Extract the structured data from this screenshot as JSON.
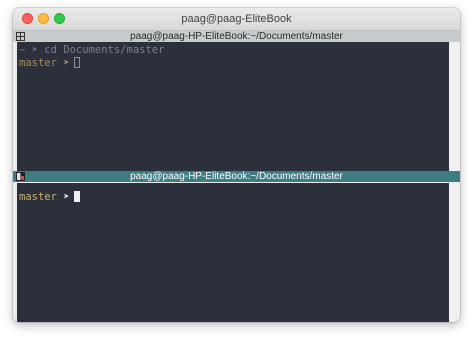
{
  "window": {
    "title": "paag@paag-EliteBook"
  },
  "top_pane": {
    "header": "",
    "history_line": {
      "tilde": "~",
      "arrow": "➤",
      "command": "cd Documents/master"
    },
    "prompt": {
      "dir": "master",
      "arrow": "➤"
    }
  },
  "bottom_pane": {
    "header": "paag@paag-HP-EliteBook:~/Documents/master",
    "prompt": {
      "dir": "master",
      "arrow": "➤"
    }
  },
  "top_pane_header_title": "paag@paag-HP-EliteBook:~/Documents/master",
  "colors": {
    "terminal_bg": "#2b303b",
    "prompt_yellow": "#c9b06d",
    "active_header": "#3f7d82",
    "inactive_header": "#c9cccd"
  }
}
